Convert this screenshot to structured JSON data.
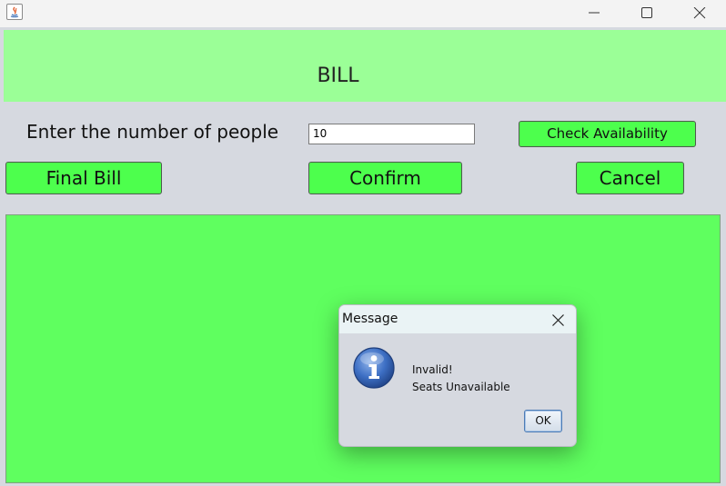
{
  "header": {
    "title": "BILL",
    "background": "#9bff97"
  },
  "form": {
    "people_label": "Enter the number of people",
    "people_value": "10",
    "check_button": "Check Availability"
  },
  "actions": {
    "final_bill": "Final Bill",
    "confirm": "Confirm",
    "cancel": "Cancel"
  },
  "colors": {
    "button": "#4dff4d",
    "panel": "#5fff5f",
    "window_bg": "#d6d9e0"
  },
  "dialog": {
    "title": "Message",
    "icon": "info-icon",
    "message_line1": "Invalid!",
    "message_line2": "Seats Unavailable",
    "ok_label": "OK"
  },
  "titlebar": {
    "icons": [
      "java-app-icon",
      "minimize-icon",
      "maximize-icon",
      "close-icon"
    ]
  }
}
